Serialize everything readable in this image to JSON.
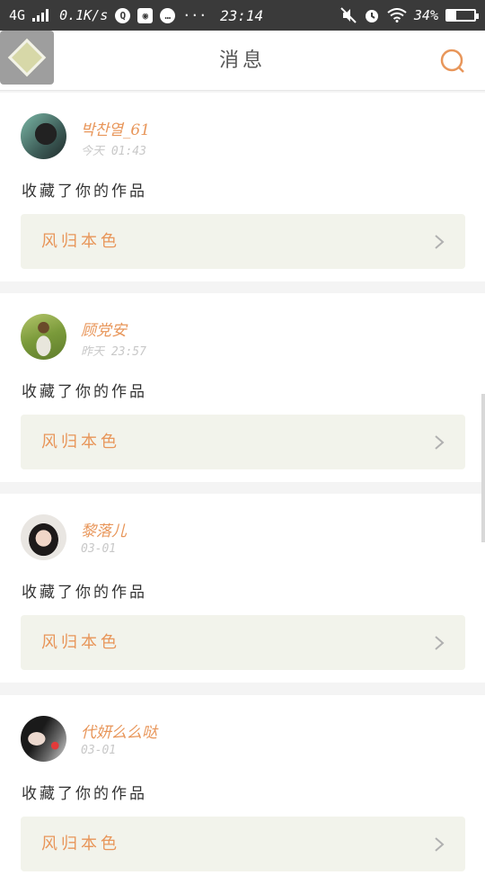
{
  "status_bar": {
    "network": "4G",
    "speed": "0.1K/s",
    "time": "23:14",
    "battery": "34%",
    "battery_level": 0.34,
    "more": "···"
  },
  "header": {
    "title": "消息"
  },
  "colors": {
    "accent": "#e8965a",
    "work_box": "#f2f3eb",
    "status_bar": "#3a3a3a"
  },
  "messages": [
    {
      "name": "박찬열_61",
      "time": "今天 01:43",
      "action": "收藏了你的作品",
      "work": "风归本色",
      "avatar": "avatar-girl-dark-hair"
    },
    {
      "name": "顾党安",
      "time": "昨天 23:57",
      "action": "收藏了你的作品",
      "work": "风归本色",
      "avatar": "avatar-girl-in-field"
    },
    {
      "name": "黎落儿",
      "time": "03-01",
      "action": "收藏了你的作品",
      "work": "风归本色",
      "avatar": "avatar-girl-portrait"
    },
    {
      "name": "代妍么么哒",
      "time": "03-01",
      "action": "收藏了你的作品",
      "work": "风归本色",
      "avatar": "avatar-girl-lying"
    }
  ]
}
